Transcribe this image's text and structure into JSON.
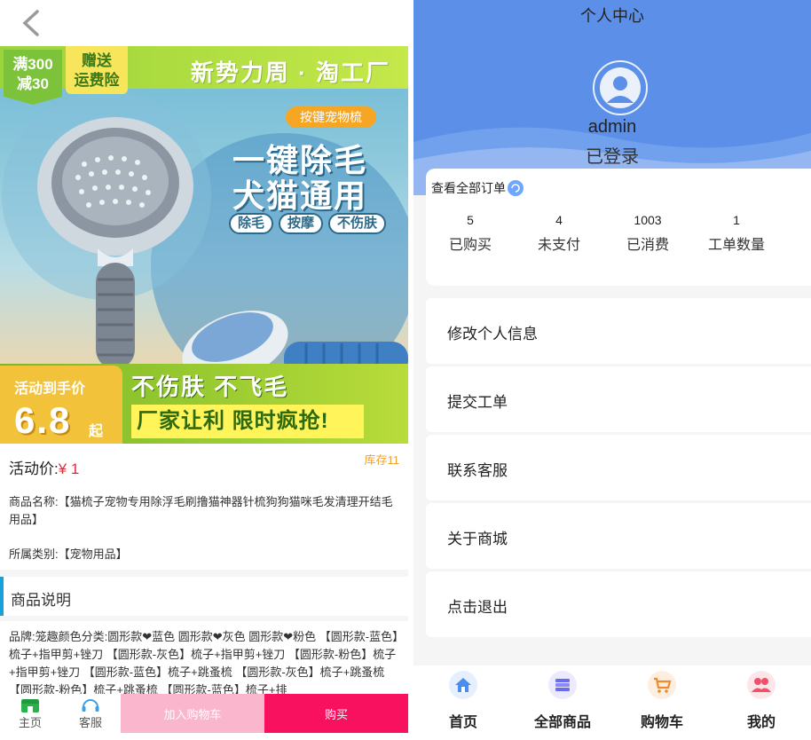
{
  "product": {
    "hero": {
      "ribbon_left": "满300\n减30",
      "ribbon_left_l1": "满300",
      "ribbon_left_l2": "减30",
      "ribbon_right_l1": "赠送",
      "ribbon_right_l2": "运费险",
      "brand": "新势力周 · 淘工厂",
      "tag": "按键宠物梳",
      "headline1": "一键除毛",
      "headline2": "犬猫通用",
      "chips": [
        "除毛",
        "按摩",
        "不伤肤"
      ],
      "promo_label": "活动到手价",
      "promo_price": "6.8",
      "promo_suffix": "起",
      "slogan1": "不伤肤 不飞毛",
      "slogan2": "厂家让利 限时疯抢!"
    },
    "price_label": "活动价:",
    "price_value": "¥ 1",
    "stock": "库存11",
    "name": "商品名称:【猫梳子宠物专用除浮毛刷撸猫神器针梳狗狗猫咪毛发清理开结毛用品】",
    "category": "所属类别:【宠物用品】",
    "desc_title": "商品说明",
    "desc_text": "品牌:笼趣颜色分类:圆形款❤蓝色 圆形款❤灰色 圆形款❤粉色 【圆形款-蓝色】梳子+指甲剪+锉刀 【圆形款-灰色】梳子+指甲剪+锉刀 【圆形款-粉色】梳子+指甲剪+锉刀 【圆形款-蓝色】梳子+跳蚤梳 【圆形款-灰色】梳子+跳蚤梳 【圆形款-粉色】梳子+跳蚤梳 【圆形款-蓝色】梳子+排",
    "bottom": {
      "home_label": "主页",
      "service_label": "客服",
      "cart_label": "加入购物车",
      "buy_label": "购买"
    }
  },
  "profile": {
    "title": "个人中心",
    "username": "admin",
    "status": "已登录",
    "orders_link": "查看全部订单",
    "stats": [
      {
        "num": "5",
        "label": "已购买"
      },
      {
        "num": "4",
        "label": "未支付"
      },
      {
        "num": "1003",
        "label": "已消费"
      },
      {
        "num": "1",
        "label": "工单数量"
      }
    ],
    "menu": [
      "修改个人信息",
      "提交工单",
      "联系客服",
      "关于商城",
      "点击退出"
    ],
    "tabs": [
      {
        "label": "首页",
        "icon": "home-icon",
        "color": "#4a8df0"
      },
      {
        "label": "全部商品",
        "icon": "goods-icon",
        "color": "#6c6cf0"
      },
      {
        "label": "购物车",
        "icon": "cart-icon",
        "color": "#f08a2c"
      },
      {
        "label": "我的",
        "icon": "user-group-icon",
        "color": "#f0506a"
      }
    ]
  },
  "colors": {
    "accent_blue": "#5b8fe8",
    "price_red": "#e0293a",
    "buy_pink": "#f7115f",
    "cart_pink": "#f9b6cd",
    "stock_orange": "#f0a030"
  }
}
